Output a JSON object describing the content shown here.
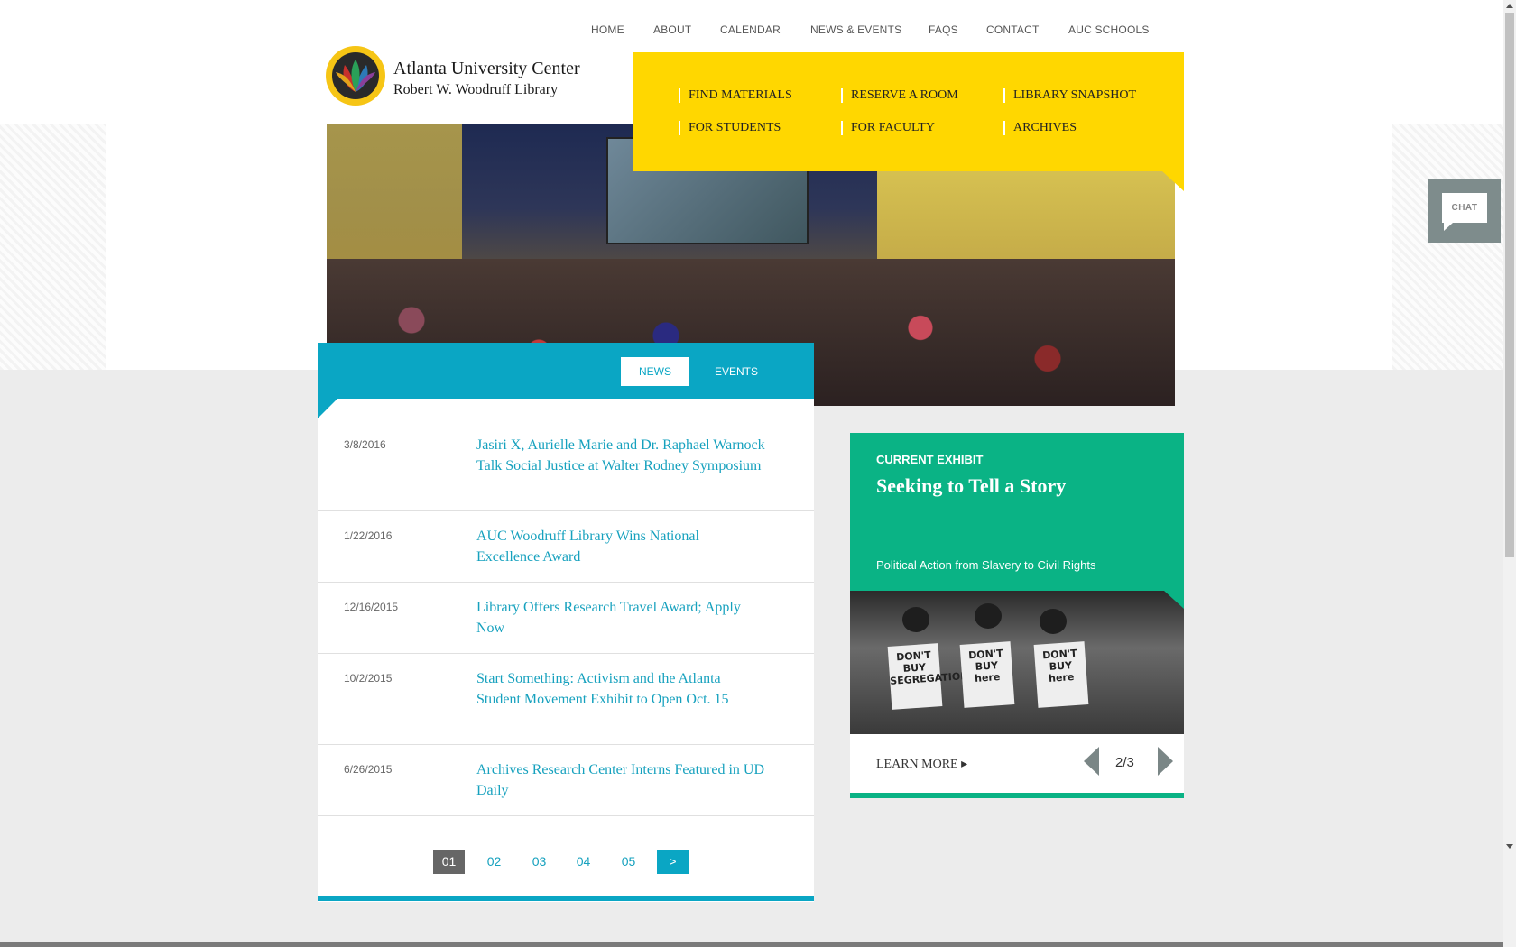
{
  "topnav": [
    "HOME",
    "ABOUT",
    "CALENDAR",
    "NEWS & EVENTS",
    "FAQS",
    "CONTACT",
    "AUC SCHOOLS"
  ],
  "logo": {
    "line1": "Atlanta University Center",
    "line2": "Robert W. Woodruff Library"
  },
  "quicklinks": [
    {
      "label": "FIND MATERIALS"
    },
    {
      "label": "RESERVE A ROOM"
    },
    {
      "label": "LIBRARY SNAPSHOT"
    },
    {
      "label": "FOR STUDENTS"
    },
    {
      "label": "FOR FACULTY"
    },
    {
      "label": "ARCHIVES"
    }
  ],
  "chat": {
    "label": "CHAT"
  },
  "news": {
    "tabs": {
      "news": "NEWS",
      "events": "EVENTS"
    },
    "items": [
      {
        "date": "3/8/2016",
        "title": "Jasiri X, Aurielle Marie and Dr. Raphael Warnock Talk Social Justice at Walter Rodney Symposium"
      },
      {
        "date": "1/22/2016",
        "title": "AUC Woodruff Library Wins National Excellence Award"
      },
      {
        "date": "12/16/2015",
        "title": "Library Offers Research Travel Award; Apply Now"
      },
      {
        "date": "10/2/2015",
        "title": "Start Something: Activism and the Atlanta Student Movement Exhibit to Open Oct. 15"
      },
      {
        "date": "6/26/2015",
        "title": "Archives Research Center Interns Featured in UD Daily"
      }
    ],
    "pagination": {
      "pages": [
        "01",
        "02",
        "03",
        "04",
        "05"
      ],
      "current": "01",
      "next": ">"
    }
  },
  "exhibit": {
    "kicker": "CURRENT EXHIBIT",
    "title": "Seeking to Tell a Story",
    "subtitle": "Political Action from Slavery to Civil Rights",
    "signs": [
      "DON'T BUY SEGREGATION",
      "DON'T BUY here",
      "DON'T BUY here"
    ],
    "learn_more": "LEARN MORE ▸",
    "counter": "2/3"
  },
  "colors": {
    "yellow": "#ffd700",
    "teal": "#0aa6c4",
    "green": "#0ab385",
    "gray": "#ececec"
  }
}
